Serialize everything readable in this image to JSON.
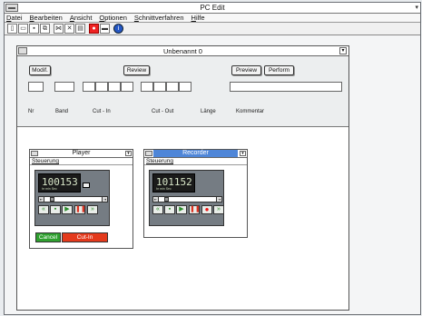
{
  "app": {
    "title": "PC Edit"
  },
  "menu": [
    "Datei",
    "Bearbeiten",
    "Ansicht",
    "Optionen",
    "Schnittverfahren",
    "Hilfe"
  ],
  "toolbar": {
    "icons": [
      "new-icon",
      "open-icon",
      "save-icon",
      "copy-icon",
      "cut-icon",
      "scissors-icon",
      "paste-icon",
      "record-icon",
      "tape-icon",
      "info-icon"
    ],
    "info_glyph": "i"
  },
  "document": {
    "title": "Unbenannt 0",
    "buttons": {
      "modif": "Modif.",
      "review": "Review",
      "preview": "Preview",
      "perform": "Perform"
    },
    "columns": [
      "Nr",
      "Band",
      "Cut - In",
      "Cut - Out",
      "Länge",
      "Kommentar"
    ]
  },
  "player": {
    "title": "Player",
    "menu": "Steuerung",
    "counter": "100153",
    "units": "hr   min  Sec",
    "cancel_label": "Cancel",
    "cutin_label": "Cut-In"
  },
  "recorder": {
    "title": "Recorder",
    "menu": "Steuerung",
    "counter": "101152",
    "units": "hr   min  Sec"
  },
  "colors": {
    "recorder_title": "#4f86d8",
    "cancel": "#2fa02f",
    "cutin": "#e43a1c",
    "record": "#e11111"
  }
}
